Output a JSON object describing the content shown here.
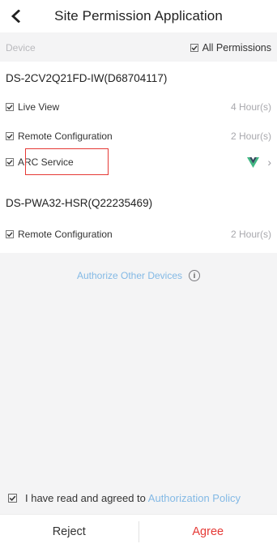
{
  "header": {
    "title": "Site Permission Application",
    "back_icon": "chevron-left-icon"
  },
  "device_bar": {
    "device_label": "Device",
    "all_permissions_label": "All Permissions",
    "all_permissions_checked": true
  },
  "devices": [
    {
      "name": "DS-2CV2Q21FD-IW(D68704117)",
      "permissions": [
        {
          "label": "Live View",
          "duration": "4 Hour(s)",
          "checked": true
        },
        {
          "label": "Remote Configuration",
          "duration": "2 Hour(s)",
          "checked": true
        },
        {
          "label": "ARC Service",
          "duration": "",
          "checked": true,
          "highlighted": true
        }
      ]
    },
    {
      "name": "DS-PWA32-HSR(Q22235469)",
      "permissions": [
        {
          "label": "Remote Configuration",
          "duration": "2 Hour(s)",
          "checked": true
        }
      ]
    }
  ],
  "authorize": {
    "label": "Authorize Other Devices",
    "info_icon": "info-icon"
  },
  "policy": {
    "prefix": "I have read and agreed to ",
    "link": "Authorization Policy",
    "checked": true
  },
  "footer": {
    "reject_label": "Reject",
    "agree_label": "Agree"
  },
  "colors": {
    "accent_link": "#83b9e5",
    "agree_red": "#e53935",
    "vue_green": "#41b883",
    "vue_dark": "#35495e"
  }
}
